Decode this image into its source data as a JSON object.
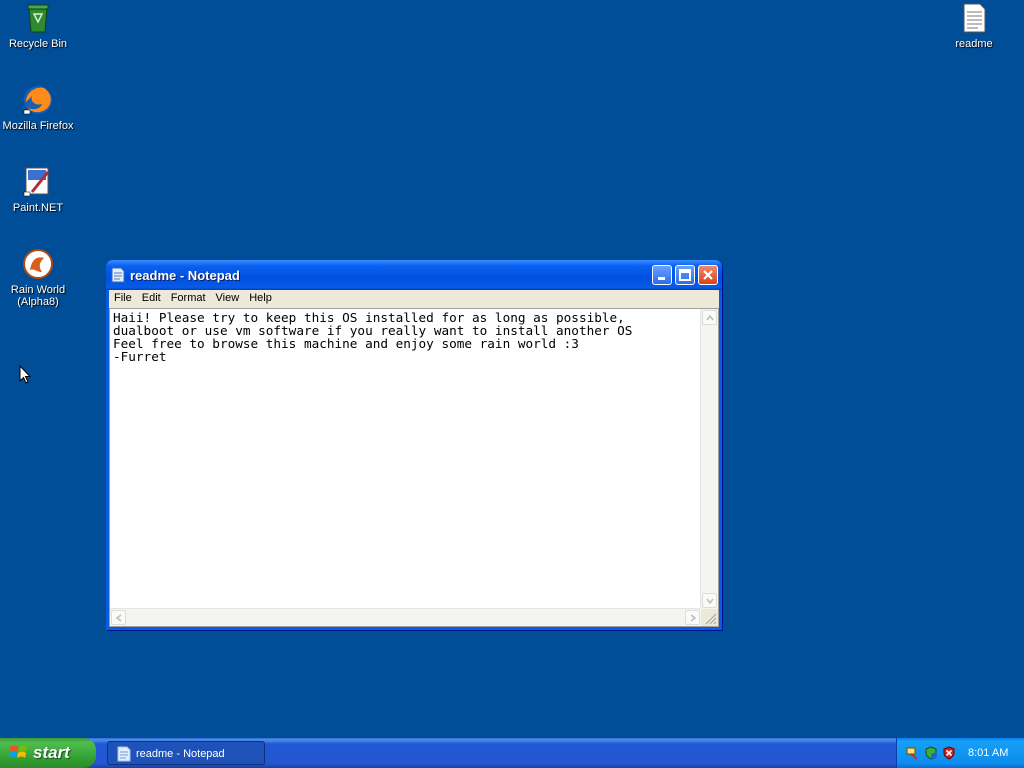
{
  "desktop": {
    "icons": [
      {
        "label": "Recycle Bin",
        "icon": "recycle-bin-icon"
      },
      {
        "label": "Mozilla Firefox",
        "icon": "firefox-icon"
      },
      {
        "label": "Paint.NET",
        "icon": "paint-net-icon"
      },
      {
        "label": "Rain World\n(Alpha8)",
        "icon": "rain-world-icon"
      },
      {
        "label": "readme",
        "icon": "text-document-icon"
      }
    ]
  },
  "window": {
    "title": "readme - Notepad",
    "menu": [
      "File",
      "Edit",
      "Format",
      "View",
      "Help"
    ],
    "content": "Haii! Please try to keep this OS installed for as long as possible,\ndualboot or use vm software if you really want to install another OS\nFeel free to browse this machine and enjoy some rain world :3\n-Furret"
  },
  "taskbar": {
    "start_label": "start",
    "task_label": "readme - Notepad",
    "clock": "8:01 AM"
  },
  "colors": {
    "desktop": "#004e98",
    "titlebar": "#0050e0",
    "taskbar": "#2457cf",
    "start": "#36a436"
  }
}
